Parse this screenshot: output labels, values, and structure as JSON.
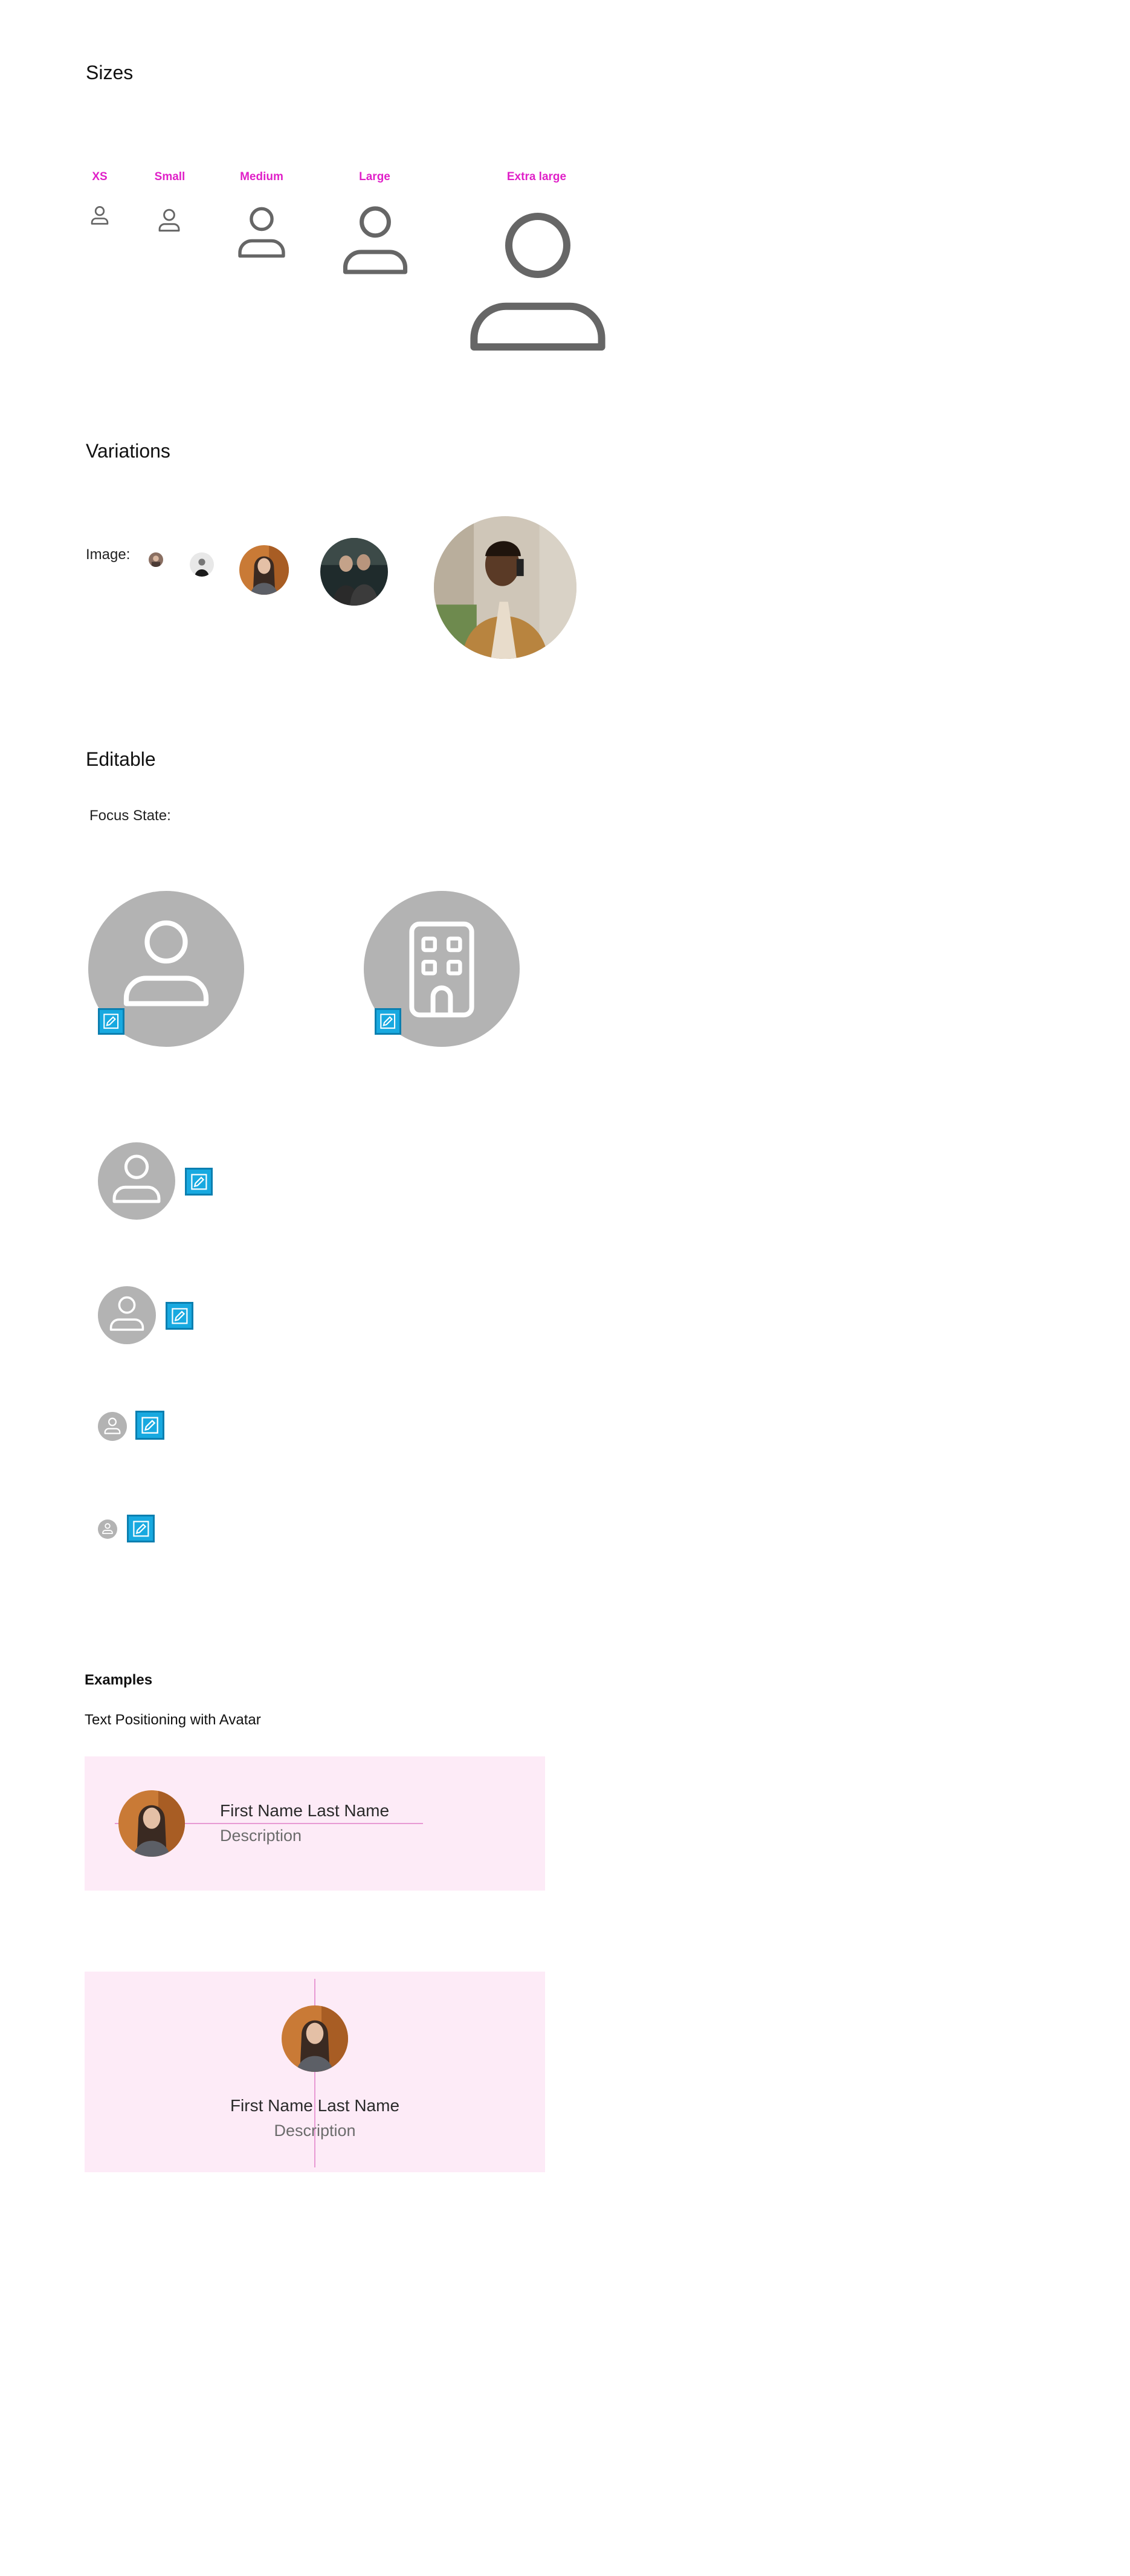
{
  "sections": {
    "sizes": "Sizes",
    "variations": "Variations",
    "editable": "Editable",
    "examples": "Examples"
  },
  "sizes": {
    "labels": [
      "XS",
      "Small",
      "Medium",
      "Large",
      "Extra large"
    ]
  },
  "variations": {
    "image_label": "Image:"
  },
  "editable": {
    "focus_state": "Focus State:"
  },
  "examples": {
    "subtitle": "Text Positioning with Avatar",
    "horizontal": {
      "name": "First Name Last Name",
      "description": "Description"
    },
    "vertical": {
      "name": "First Name Last Name",
      "description": "Description"
    }
  },
  "colors": {
    "size_label": "#e020c8",
    "icon_gray": "#666666",
    "avatar_gray": "#b3b3b3",
    "edit_badge": "#18a9e0",
    "example_bg": "#fdebf7",
    "guide_line": "#e89ad4"
  },
  "icons": {
    "person": "person-icon",
    "building": "building-icon",
    "edit": "edit-icon"
  }
}
